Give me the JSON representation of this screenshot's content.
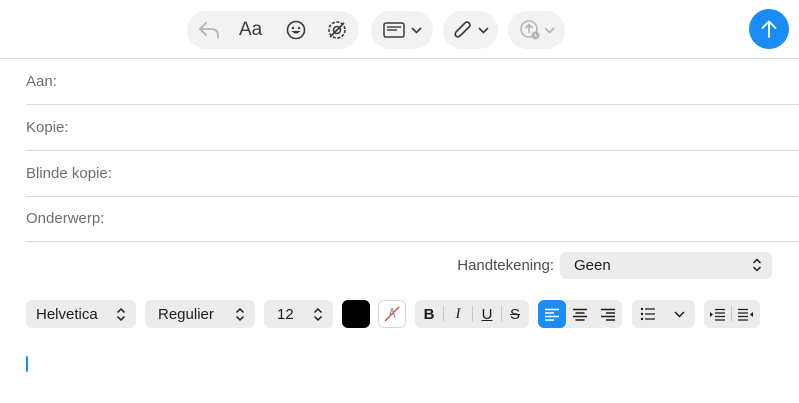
{
  "toolbar": {
    "reply_icon": "reply-arrow-icon",
    "font_label": "Aa",
    "emoji_icon": "smiley-icon",
    "photo_icon": "photo-browser-icon",
    "header_fields_icon": "header-fields-icon",
    "attachment_icon": "paperclip-icon",
    "send_later_icon": "send-later-icon",
    "send_icon": "arrow-up-icon"
  },
  "fields": {
    "to_label": "Aan:",
    "cc_label": "Kopie:",
    "bcc_label": "Blinde kopie:",
    "subject_label": "Onderwerp:"
  },
  "signature": {
    "label": "Handtekening:",
    "value": "Geen"
  },
  "format": {
    "font_family": "Helvetica",
    "font_style": "Regulier",
    "font_size": "12",
    "text_color": "#000000",
    "bold": "B",
    "italic": "I",
    "underline": "U",
    "strike": "S",
    "active_alignment": "left"
  },
  "colors": {
    "accent": "#1a8cf5",
    "control_bg": "#ececed"
  }
}
